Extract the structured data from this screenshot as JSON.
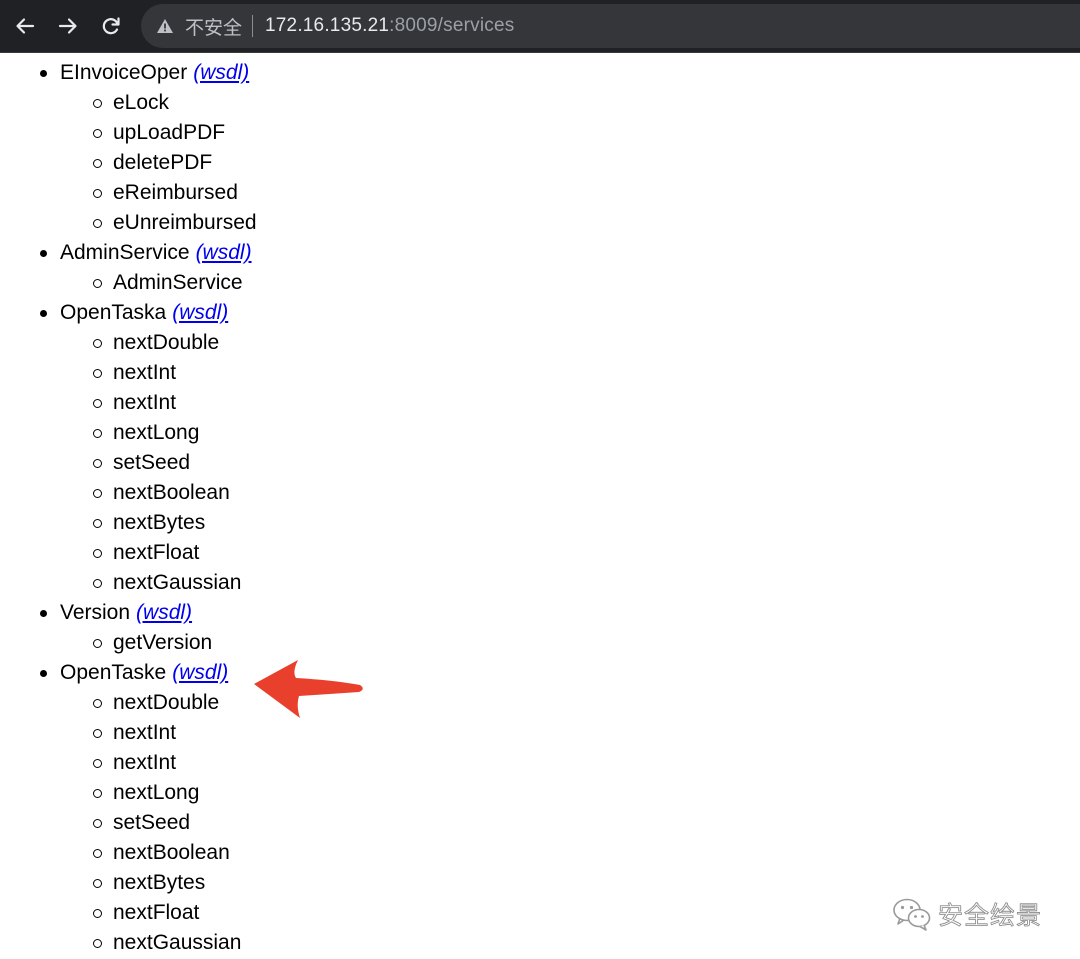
{
  "browser": {
    "security_label": "不安全",
    "url_host": "172.16.135.21",
    "url_rest": ":8009/services"
  },
  "wsdl_label": "(wsdl)",
  "services": [
    {
      "name": "EInvoiceOper",
      "ops": [
        "eLock",
        "upLoadPDF",
        "deletePDF",
        "eReimbursed",
        "eUnreimbursed"
      ]
    },
    {
      "name": "AdminService",
      "ops": [
        "AdminService"
      ]
    },
    {
      "name": "OpenTaska",
      "ops": [
        "nextDouble",
        "nextInt",
        "nextInt",
        "nextLong",
        "setSeed",
        "nextBoolean",
        "nextBytes",
        "nextFloat",
        "nextGaussian"
      ]
    },
    {
      "name": "Version",
      "ops": [
        "getVersion"
      ]
    },
    {
      "name": "OpenTaske",
      "ops": [
        "nextDouble",
        "nextInt",
        "nextInt",
        "nextLong",
        "setSeed",
        "nextBoolean",
        "nextBytes",
        "nextFloat",
        "nextGaussian"
      ]
    }
  ],
  "annotation": {
    "arrow_color": "#e8402c"
  },
  "watermark": {
    "text": "安全绘景"
  }
}
